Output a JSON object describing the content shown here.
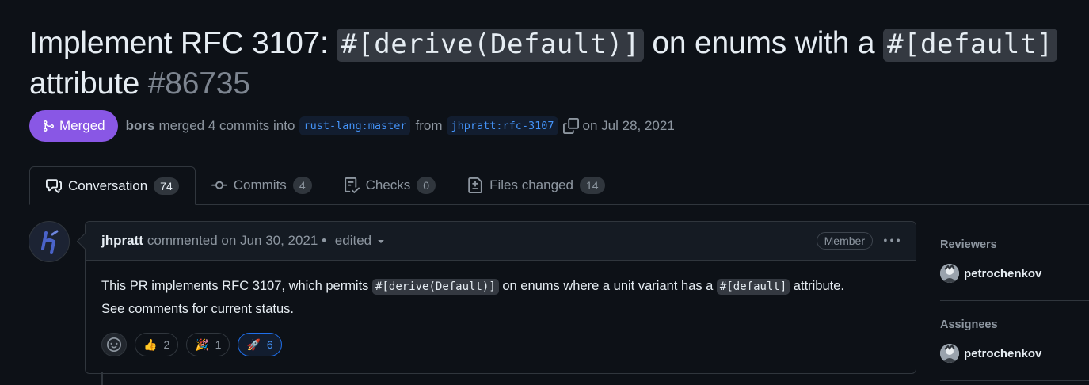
{
  "title": {
    "part1": "Implement RFC 3107: ",
    "code1": "#[derive(Default)]",
    "part2": " on enums with a ",
    "code2": "#[default]",
    "part3": " attribute ",
    "number": "#86735"
  },
  "meta": {
    "state": "Merged",
    "state_color": "#8957e5",
    "author": "bors",
    "action": "merged 4 commits into",
    "base_branch": "rust-lang:master",
    "from": "from",
    "head_branch": "jhpratt:rfc-3107",
    "date": "on Jul 28, 2021"
  },
  "tabs": [
    {
      "label": "Conversation",
      "count": "74",
      "icon": "comment-discussion-icon"
    },
    {
      "label": "Commits",
      "count": "4",
      "icon": "git-commit-icon"
    },
    {
      "label": "Checks",
      "count": "0",
      "icon": "checklist-icon"
    },
    {
      "label": "Files changed",
      "count": "14",
      "icon": "file-diff-icon"
    }
  ],
  "comment": {
    "author": "jhpratt",
    "meta": "commented on Jun 30, 2021 • ",
    "edited": "edited",
    "role": "Member",
    "body": {
      "t1": "This PR implements RFC 3107, which permits ",
      "c1": "#[derive(Default)]",
      "t2": " on enums where a unit variant has a ",
      "c2": "#[default]",
      "t3": " attribute.",
      "line2": "See comments for current status."
    },
    "reactions": [
      {
        "emoji": "👍",
        "name": "thumbs-up",
        "count": "2"
      },
      {
        "emoji": "🎉",
        "name": "hooray",
        "count": "1"
      },
      {
        "emoji": "🚀",
        "name": "rocket",
        "count": "6"
      }
    ]
  },
  "sidebar": {
    "reviewers_heading": "Reviewers",
    "reviewer": "petrochenkov",
    "assignees_heading": "Assignees",
    "assignee": "petrochenkov"
  }
}
